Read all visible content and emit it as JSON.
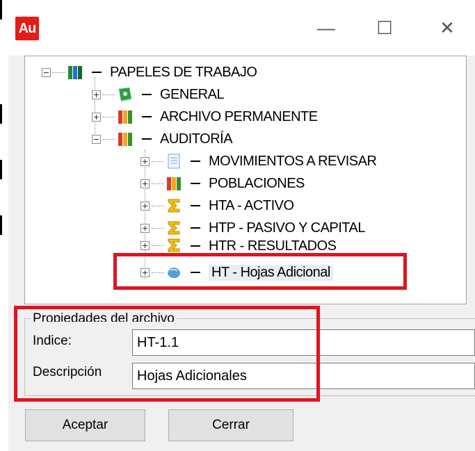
{
  "window": {
    "app_icon_text": "Au",
    "minimize_glyph": "—",
    "maximize_glyph": "☐",
    "close_glyph": "✕"
  },
  "tree": {
    "root": {
      "label": "PAPELES DE TRABAJO",
      "icon": "books-icon",
      "expanded": true
    },
    "level1": [
      {
        "label": "GENERAL",
        "icon": "green-book-icon",
        "expanded": false
      },
      {
        "label": "ARCHIVO PERMANENTE",
        "icon": "books-icon",
        "expanded": false
      },
      {
        "label": "AUDITORÍA",
        "icon": "books-icon",
        "expanded": true
      }
    ],
    "level2": [
      {
        "label": "MOVIMIENTOS A REVISAR",
        "icon": "document-icon"
      },
      {
        "label": "POBLACIONES",
        "icon": "books-icon"
      },
      {
        "label": "HTA - ACTIVO",
        "icon": "sigma-icon"
      },
      {
        "label": "HTP - PASIVO Y CAPITAL",
        "icon": "sigma-icon"
      },
      {
        "label": "HTR - RESULTADOS",
        "icon": "sigma-icon"
      },
      {
        "label": "HT - Hojas Adicional",
        "icon": "blue-shape-icon",
        "selected": true
      }
    ]
  },
  "properties": {
    "group_title": "Propiedades del archivo",
    "indice_label": "Indice:",
    "indice_value": "HT-1.1",
    "descripcion_label": "Descripción",
    "descripcion_value": "Hojas Adicionales"
  },
  "buttons": {
    "accept": "Aceptar",
    "close": "Cerrar"
  },
  "colors": {
    "highlight": "#e0141f",
    "app_icon": "#e41b17"
  }
}
